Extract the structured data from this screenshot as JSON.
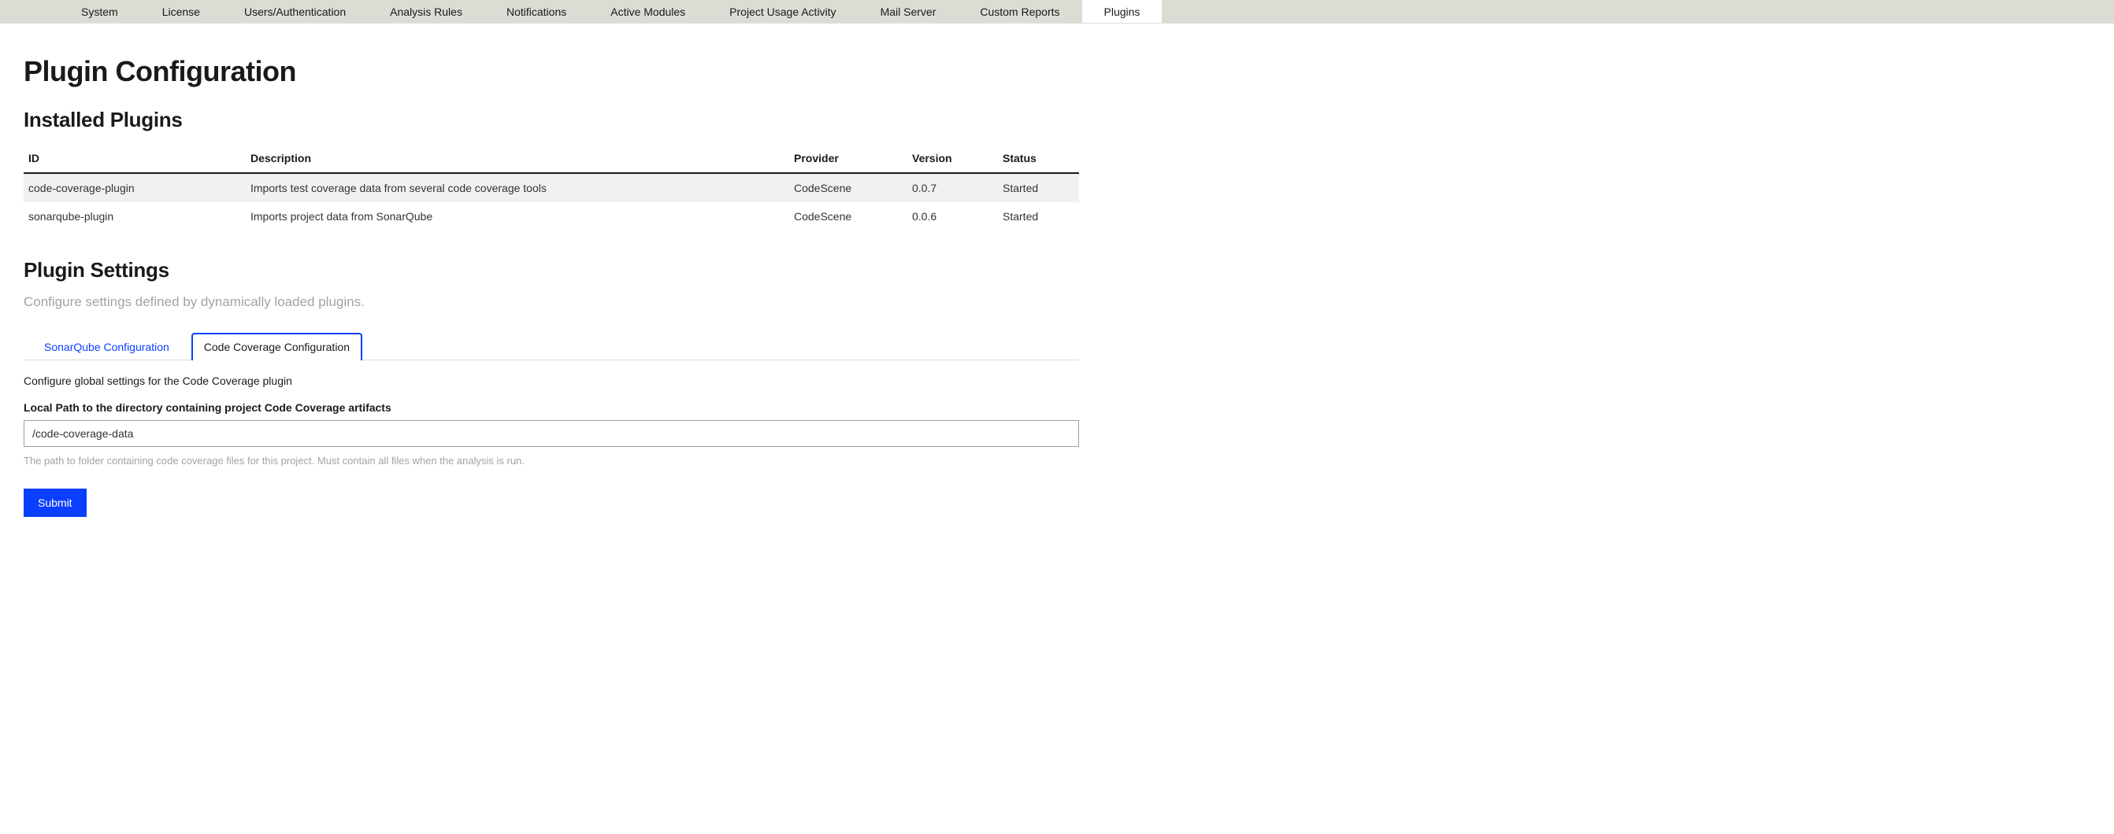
{
  "nav": {
    "items": [
      {
        "label": "System",
        "active": false
      },
      {
        "label": "License",
        "active": false
      },
      {
        "label": "Users/Authentication",
        "active": false
      },
      {
        "label": "Analysis Rules",
        "active": false
      },
      {
        "label": "Notifications",
        "active": false
      },
      {
        "label": "Active Modules",
        "active": false
      },
      {
        "label": "Project Usage Activity",
        "active": false
      },
      {
        "label": "Mail Server",
        "active": false
      },
      {
        "label": "Custom Reports",
        "active": false
      },
      {
        "label": "Plugins",
        "active": true
      }
    ]
  },
  "page": {
    "title": "Plugin Configuration"
  },
  "installed": {
    "heading": "Installed Plugins",
    "columns": {
      "id": "ID",
      "description": "Description",
      "provider": "Provider",
      "version": "Version",
      "status": "Status"
    },
    "rows": [
      {
        "id": "code-coverage-plugin",
        "description": "Imports test coverage data from several code coverage tools",
        "provider": "CodeScene",
        "version": "0.0.7",
        "status": "Started"
      },
      {
        "id": "sonarqube-plugin",
        "description": "Imports project data from SonarQube",
        "provider": "CodeScene",
        "version": "0.0.6",
        "status": "Started"
      }
    ]
  },
  "settings": {
    "heading": "Plugin Settings",
    "subtitle": "Configure settings defined by dynamically loaded plugins.",
    "tabs": [
      {
        "label": "SonarQube Configuration",
        "active": false
      },
      {
        "label": "Code Coverage Configuration",
        "active": true
      }
    ],
    "panel": {
      "description": "Configure global settings for the Code Coverage plugin",
      "field_label": "Local Path to the directory containing project Code Coverage artifacts",
      "field_value": "/code-coverage-data",
      "help_text": "The path to folder containing code coverage files for this project. Must contain all files when the analysis is run.",
      "submit_label": "Submit"
    }
  }
}
